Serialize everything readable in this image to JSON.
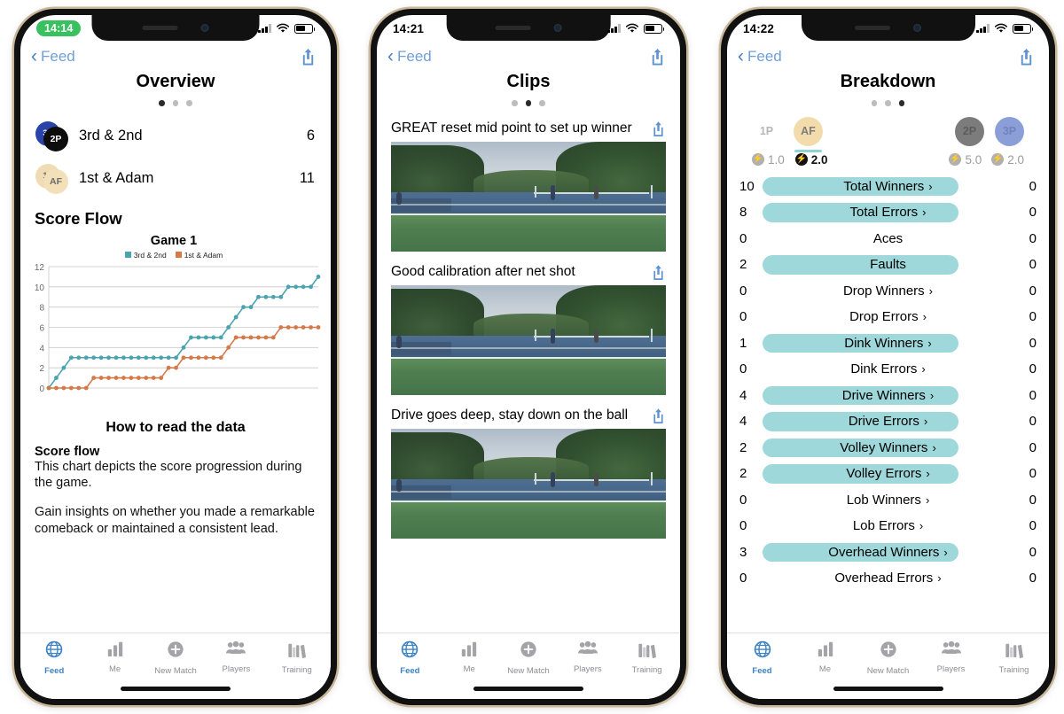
{
  "phones": [
    {
      "id": "overview",
      "status": {
        "time": "14:14",
        "time_pill": true
      },
      "nav": {
        "back_label": "Feed",
        "share_icon": "share-icon"
      },
      "title": "Overview",
      "dots": {
        "count": 3,
        "active": 0
      },
      "teams": [
        {
          "name": "3rd & 2nd",
          "score": "6",
          "avatar_back": "3P",
          "avatar_front": "2P",
          "color_back": "#2a43a8",
          "color_front": "#0d0d0d"
        },
        {
          "name": "1st & Adam",
          "score": "11",
          "avatar_back": "1P",
          "avatar_front": "AF",
          "color_back": "#f0dcb4",
          "color_front": "#f3dfb8"
        }
      ],
      "section_title": "Score Flow",
      "howto": {
        "title": "How to read the data",
        "heading": "Score flow",
        "paragraph1": "This chart depicts the score progression during the game.",
        "paragraph2": "Gain insights on whether you made a remarkable comeback or maintained a consistent lead."
      }
    },
    {
      "id": "clips",
      "status": {
        "time": "14:21",
        "time_pill": false
      },
      "nav": {
        "back_label": "Feed",
        "share_icon": "share-icon"
      },
      "title": "Clips",
      "dots": {
        "count": 3,
        "active": 1
      },
      "clips": [
        {
          "title": "GREAT reset mid point to set up winner"
        },
        {
          "title": "Good calibration after net shot"
        },
        {
          "title": "Drive goes deep, stay down on the ball"
        }
      ]
    },
    {
      "id": "breakdown",
      "status": {
        "time": "14:22",
        "time_pill": false
      },
      "nav": {
        "back_label": "Feed",
        "share_icon": "share-icon"
      },
      "title": "Breakdown",
      "dots": {
        "count": 3,
        "active": 2
      },
      "players_left": [
        {
          "label": "1P",
          "selected": false,
          "ghost": true,
          "color": "transparent"
        },
        {
          "label": "AF",
          "selected": true,
          "ghost": false,
          "color": "#f3dcab"
        }
      ],
      "players_right": [
        {
          "label": "2P",
          "selected": false,
          "ghost": false,
          "color": "#7c7c7c"
        },
        {
          "label": "3P",
          "selected": false,
          "ghost": false,
          "color": "#8b9ed8"
        }
      ],
      "ratings_left": [
        {
          "value": "1.0",
          "dark": false
        },
        {
          "value": "2.0",
          "dark": true
        }
      ],
      "ratings_right": [
        {
          "value": "5.0",
          "dark": false
        },
        {
          "value": "2.0",
          "dark": false
        }
      ]
    }
  ],
  "breakdown_stats": [
    {
      "label": "Total Winners",
      "left": "10",
      "right": "0",
      "bar": true,
      "chevron": true
    },
    {
      "label": "Total Errors",
      "left": "8",
      "right": "0",
      "bar": true,
      "chevron": true
    },
    {
      "label": "Aces",
      "left": "0",
      "right": "0",
      "bar": false,
      "chevron": false
    },
    {
      "label": "Faults",
      "left": "2",
      "right": "0",
      "bar": true,
      "chevron": false
    },
    {
      "label": "Drop Winners",
      "left": "0",
      "right": "0",
      "bar": false,
      "chevron": true
    },
    {
      "label": "Drop Errors",
      "left": "0",
      "right": "0",
      "bar": false,
      "chevron": true
    },
    {
      "label": "Dink Winners",
      "left": "1",
      "right": "0",
      "bar": true,
      "chevron": true
    },
    {
      "label": "Dink Errors",
      "left": "0",
      "right": "0",
      "bar": false,
      "chevron": true
    },
    {
      "label": "Drive Winners",
      "left": "4",
      "right": "0",
      "bar": true,
      "chevron": true
    },
    {
      "label": "Drive Errors",
      "left": "4",
      "right": "0",
      "bar": true,
      "chevron": true
    },
    {
      "label": "Volley Winners",
      "left": "2",
      "right": "0",
      "bar": true,
      "chevron": true
    },
    {
      "label": "Volley Errors",
      "left": "2",
      "right": "0",
      "bar": true,
      "chevron": true
    },
    {
      "label": "Lob Winners",
      "left": "0",
      "right": "0",
      "bar": false,
      "chevron": true
    },
    {
      "label": "Lob Errors",
      "left": "0",
      "right": "0",
      "bar": false,
      "chevron": true
    },
    {
      "label": "Overhead Winners",
      "left": "3",
      "right": "0",
      "bar": true,
      "chevron": true
    },
    {
      "label": "Overhead Errors",
      "left": "0",
      "right": "0",
      "bar": false,
      "chevron": true
    }
  ],
  "tabbar": {
    "items": [
      {
        "label": "Feed",
        "icon": "globe-icon",
        "active": true
      },
      {
        "label": "Me",
        "icon": "bar-chart-icon",
        "active": false
      },
      {
        "label": "New Match",
        "icon": "plus-circle-icon",
        "active": false
      },
      {
        "label": "Players",
        "icon": "people-icon",
        "active": false
      },
      {
        "label": "Training",
        "icon": "books-icon",
        "active": false
      }
    ]
  },
  "colors": {
    "team_a": "#4ba3b0",
    "team_b": "#d4794a",
    "bar_fill": "#9ed8da",
    "link_blue": "#5c92cf",
    "tab_active": "#3d82c4"
  },
  "chart_data": {
    "type": "line",
    "title": "Game 1",
    "xlabel": "",
    "ylabel": "",
    "ylim": [
      0,
      12
    ],
    "yticks": [
      0,
      2,
      4,
      6,
      8,
      10,
      12
    ],
    "grid": true,
    "legend_position": "top",
    "x": [
      0,
      1,
      2,
      3,
      4,
      5,
      6,
      7,
      8,
      9,
      10,
      11,
      12,
      13,
      14,
      15,
      16,
      17,
      18,
      19,
      20,
      21,
      22,
      23,
      24,
      25,
      26,
      27,
      28,
      29,
      30,
      31,
      32,
      33,
      34,
      35,
      36
    ],
    "series": [
      {
        "name": "3rd & 2nd",
        "color": "#4ba3b0",
        "values": [
          0,
          1,
          2,
          3,
          3,
          3,
          3,
          3,
          3,
          3,
          3,
          3,
          3,
          3,
          3,
          3,
          3,
          3,
          4,
          5,
          5,
          5,
          5,
          5,
          6,
          7,
          8,
          8,
          9,
          9,
          9,
          9,
          10,
          10,
          10,
          10,
          11
        ]
      },
      {
        "name": "1st & Adam",
        "color": "#d4794a",
        "values": [
          0,
          0,
          0,
          0,
          0,
          0,
          1,
          1,
          1,
          1,
          1,
          1,
          1,
          1,
          1,
          1,
          2,
          2,
          3,
          3,
          3,
          3,
          3,
          3,
          4,
          5,
          5,
          5,
          5,
          5,
          5,
          6,
          6,
          6,
          6,
          6,
          6
        ]
      }
    ]
  }
}
